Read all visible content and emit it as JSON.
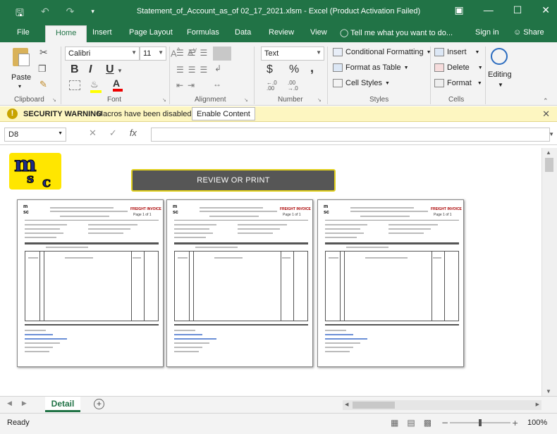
{
  "window": {
    "title": "Statement_of_Account_as_of 02_17_2021.xlsm  -  Excel (Product Activation Failed)"
  },
  "ribbon_tabs": [
    "File",
    "Home",
    "Insert",
    "Page Layout",
    "Formulas",
    "Data",
    "Review",
    "View"
  ],
  "tell_me": "Tell me what you want to do...",
  "sign_in": "Sign in",
  "share": "Share",
  "clipboard": {
    "paste": "Paste",
    "label": "Clipboard"
  },
  "font": {
    "name": "Calibri",
    "size": "11",
    "label": "Font",
    "bold": "B",
    "italic": "I",
    "underline": "U"
  },
  "alignment": {
    "label": "Alignment"
  },
  "number": {
    "format": "Text",
    "label": "Number",
    "currency": "$",
    "percent": "%",
    "comma": ","
  },
  "styles": {
    "conditional": "Conditional Formatting",
    "format_table": "Format as Table",
    "cell_styles": "Cell Styles",
    "label": "Styles"
  },
  "cells": {
    "insert": "Insert",
    "delete": "Delete",
    "format": "Format",
    "label": "Cells"
  },
  "editing": {
    "label": "Editing"
  },
  "security": {
    "title": "SECURITY WARNING",
    "message": "Macros have been disabled.",
    "button": "Enable Content"
  },
  "formula_bar": {
    "name_box": "D8",
    "fx": "fx"
  },
  "content": {
    "review_button": "REVIEW OR PRINT",
    "logo_letters": [
      "m",
      "s",
      "c"
    ],
    "doc_header_red": "FREIGHT INVOICE",
    "doc_page": "Page 1 of 1"
  },
  "sheet_tab": "Detail",
  "status": {
    "ready": "Ready",
    "zoom": "100%"
  },
  "colors": {
    "excel_green": "#217346",
    "warning_bg": "#fdf6c1",
    "logo_yellow": "#ffe600",
    "logo_blue": "#1d2b8a"
  }
}
